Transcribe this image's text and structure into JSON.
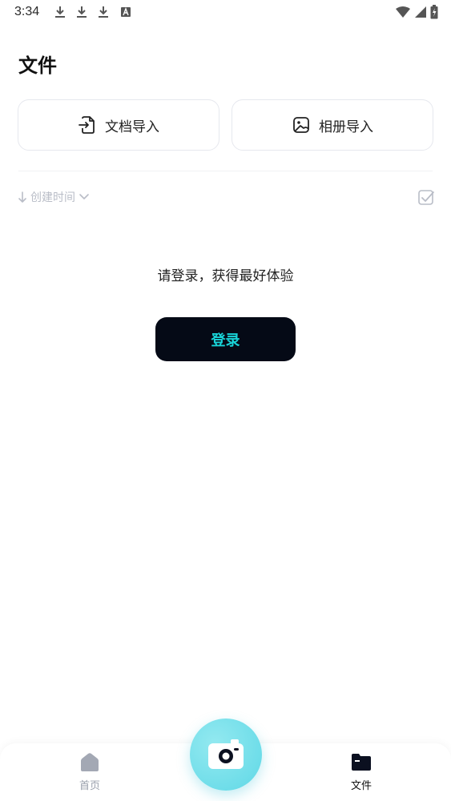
{
  "status_bar": {
    "time": "3:34",
    "icons": [
      "download-icon",
      "download-icon",
      "download-icon",
      "keyboard-a-icon",
      "wifi-icon",
      "signal-icon",
      "battery-charging-icon"
    ]
  },
  "page": {
    "title": "文件"
  },
  "import": {
    "doc_label": "文档导入",
    "album_label": "相册导入"
  },
  "sort": {
    "label": "创建时间"
  },
  "empty_state": {
    "hint": "请登录，获得最好体验",
    "login_label": "登录"
  },
  "tabs": {
    "home_label": "首页",
    "files_label": "文件"
  },
  "colors": {
    "accent": "#19d4d8",
    "button_bg": "#050a16",
    "fab": "#6fdeea",
    "muted": "#b9bdc7"
  }
}
